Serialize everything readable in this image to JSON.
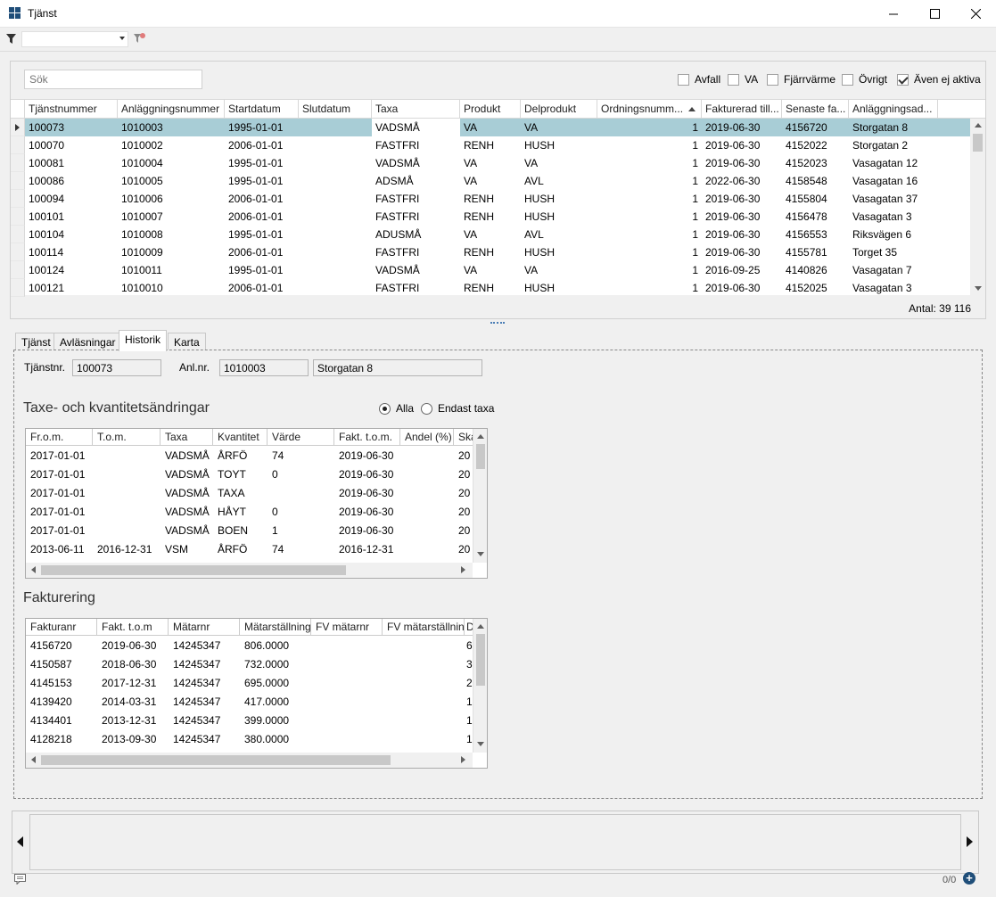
{
  "window": {
    "title": "Tjänst",
    "minimize_icon": "minimize-icon",
    "maximize_icon": "maximize-icon",
    "close_icon": "close-icon"
  },
  "toolbar": {
    "filter_icon": "filter-icon",
    "filter_value": "",
    "clear_filter_icon": "clear-filter-icon"
  },
  "search": {
    "placeholder": "Sök"
  },
  "filters": [
    {
      "label": "Avfall",
      "checked": false
    },
    {
      "label": "VA",
      "checked": false
    },
    {
      "label": "Fjärrvärme",
      "checked": false
    },
    {
      "label": "Övrigt",
      "checked": false
    },
    {
      "label": "Även ej aktiva",
      "checked": true
    }
  ],
  "grid": {
    "columns": [
      "Tjänstnummer",
      "Anläggningsnummer",
      "Startdatum",
      "Slutdatum",
      "Taxa",
      "Produkt",
      "Delprodukt",
      "Ordningsnumm...",
      "Fakturerad till...",
      "Senaste fa...",
      "Anläggningsad..."
    ],
    "sorted_column": "Ordningsnumm...",
    "rows": [
      [
        "100073",
        "1010003",
        "1995-01-01",
        "",
        "VADSMÅ",
        "VA",
        "VA",
        "1",
        "2019-06-30",
        "4156720",
        "Storgatan 8"
      ],
      [
        "100070",
        "1010002",
        "2006-01-01",
        "",
        "FASTFRI",
        "RENH",
        "HUSH",
        "1",
        "2019-06-30",
        "4152022",
        "Storgatan 2"
      ],
      [
        "100081",
        "1010004",
        "1995-01-01",
        "",
        "VADSMÅ",
        "VA",
        "VA",
        "1",
        "2019-06-30",
        "4152023",
        "Vasagatan 12"
      ],
      [
        "100086",
        "1010005",
        "1995-01-01",
        "",
        "ADSMÅ",
        "VA",
        "AVL",
        "1",
        "2022-06-30",
        "4158548",
        "Vasagatan 16"
      ],
      [
        "100094",
        "1010006",
        "2006-01-01",
        "",
        "FASTFRI",
        "RENH",
        "HUSH",
        "1",
        "2019-06-30",
        "4155804",
        "Vasagatan 37"
      ],
      [
        "100101",
        "1010007",
        "2006-01-01",
        "",
        "FASTFRI",
        "RENH",
        "HUSH",
        "1",
        "2019-06-30",
        "4156478",
        "Vasagatan 3"
      ],
      [
        "100104",
        "1010008",
        "1995-01-01",
        "",
        "ADUSMÅ",
        "VA",
        "AVL",
        "1",
        "2019-06-30",
        "4156553",
        "Riksvägen 6"
      ],
      [
        "100114",
        "1010009",
        "2006-01-01",
        "",
        "FASTFRI",
        "RENH",
        "HUSH",
        "1",
        "2019-06-30",
        "4155781",
        "Torget 35"
      ],
      [
        "100124",
        "1010011",
        "1995-01-01",
        "",
        "VADSMÅ",
        "VA",
        "VA",
        "1",
        "2016-09-25",
        "4140826",
        "Vasagatan 7"
      ],
      [
        "100121",
        "1010010",
        "2006-01-01",
        "",
        "FASTFRI",
        "RENH",
        "HUSH",
        "1",
        "2019-06-30",
        "4152025",
        "Vasagatan 3"
      ]
    ],
    "selected_row": 0,
    "count_label": "Antal: 39 116"
  },
  "tabs": [
    {
      "label": "Tjänst",
      "active": false
    },
    {
      "label": "Avläsningar",
      "active": false
    },
    {
      "label": "Historik",
      "active": true
    },
    {
      "label": "Karta",
      "active": false
    }
  ],
  "detail": {
    "service_label": "Tjänstnr.",
    "service_value": "100073",
    "facility_label": "Anl.nr.",
    "facility_value": "1010003",
    "address_value": "Storgatan 8"
  },
  "changes": {
    "title": "Taxe- och kvantitetsändringar",
    "radio_all": "Alla",
    "radio_only_tariff": "Endast taxa",
    "radio_selected": "Alla",
    "columns": [
      "Fr.o.m.",
      "T.o.m.",
      "Taxa",
      "Kvantitet",
      "Värde",
      "Fakt. t.o.m.",
      "Andel (%)",
      "Ska"
    ],
    "rows": [
      [
        "2017-01-01",
        "",
        "VADSMÅ",
        "ÅRFÖ",
        "74",
        "2019-06-30",
        "",
        "20"
      ],
      [
        "2017-01-01",
        "",
        "VADSMÅ",
        "TOYT",
        "0",
        "2019-06-30",
        "",
        "20"
      ],
      [
        "2017-01-01",
        "",
        "VADSMÅ",
        "TAXA",
        "",
        "2019-06-30",
        "",
        "20"
      ],
      [
        "2017-01-01",
        "",
        "VADSMÅ",
        "HÅYT",
        "0",
        "2019-06-30",
        "",
        "20"
      ],
      [
        "2017-01-01",
        "",
        "VADSMÅ",
        "BOEN",
        "1",
        "2019-06-30",
        "",
        "20"
      ],
      [
        "2013-06-11",
        "2016-12-31",
        "VSM",
        "ÅRFÖ",
        "74",
        "2016-12-31",
        "",
        "20"
      ]
    ]
  },
  "billing": {
    "title": "Fakturering",
    "columns": [
      "Fakturanr",
      "Fakt. t.o.m",
      "Mätarnr",
      "Mätarställning",
      "FV mätarnr",
      "FV mätarställning",
      "D"
    ],
    "rows": [
      [
        "4156720",
        "2019-06-30",
        "14245347",
        "806.0000",
        "",
        "",
        "6"
      ],
      [
        "4150587",
        "2018-06-30",
        "14245347",
        "732.0000",
        "",
        "",
        "3"
      ],
      [
        "4145153",
        "2017-12-31",
        "14245347",
        "695.0000",
        "",
        "",
        "2"
      ],
      [
        "4139420",
        "2014-03-31",
        "14245347",
        "417.0000",
        "",
        "",
        "1"
      ],
      [
        "4134401",
        "2013-12-31",
        "14245347",
        "399.0000",
        "",
        "",
        "1"
      ],
      [
        "4128218",
        "2013-09-30",
        "14245347",
        "380.0000",
        "",
        "",
        "1"
      ]
    ]
  },
  "bottom": {
    "counter": "0/0",
    "comment_icon": "comment-icon",
    "add_icon": "add-icon",
    "prev_icon": "arrow-left-icon",
    "next_icon": "arrow-right-icon"
  }
}
